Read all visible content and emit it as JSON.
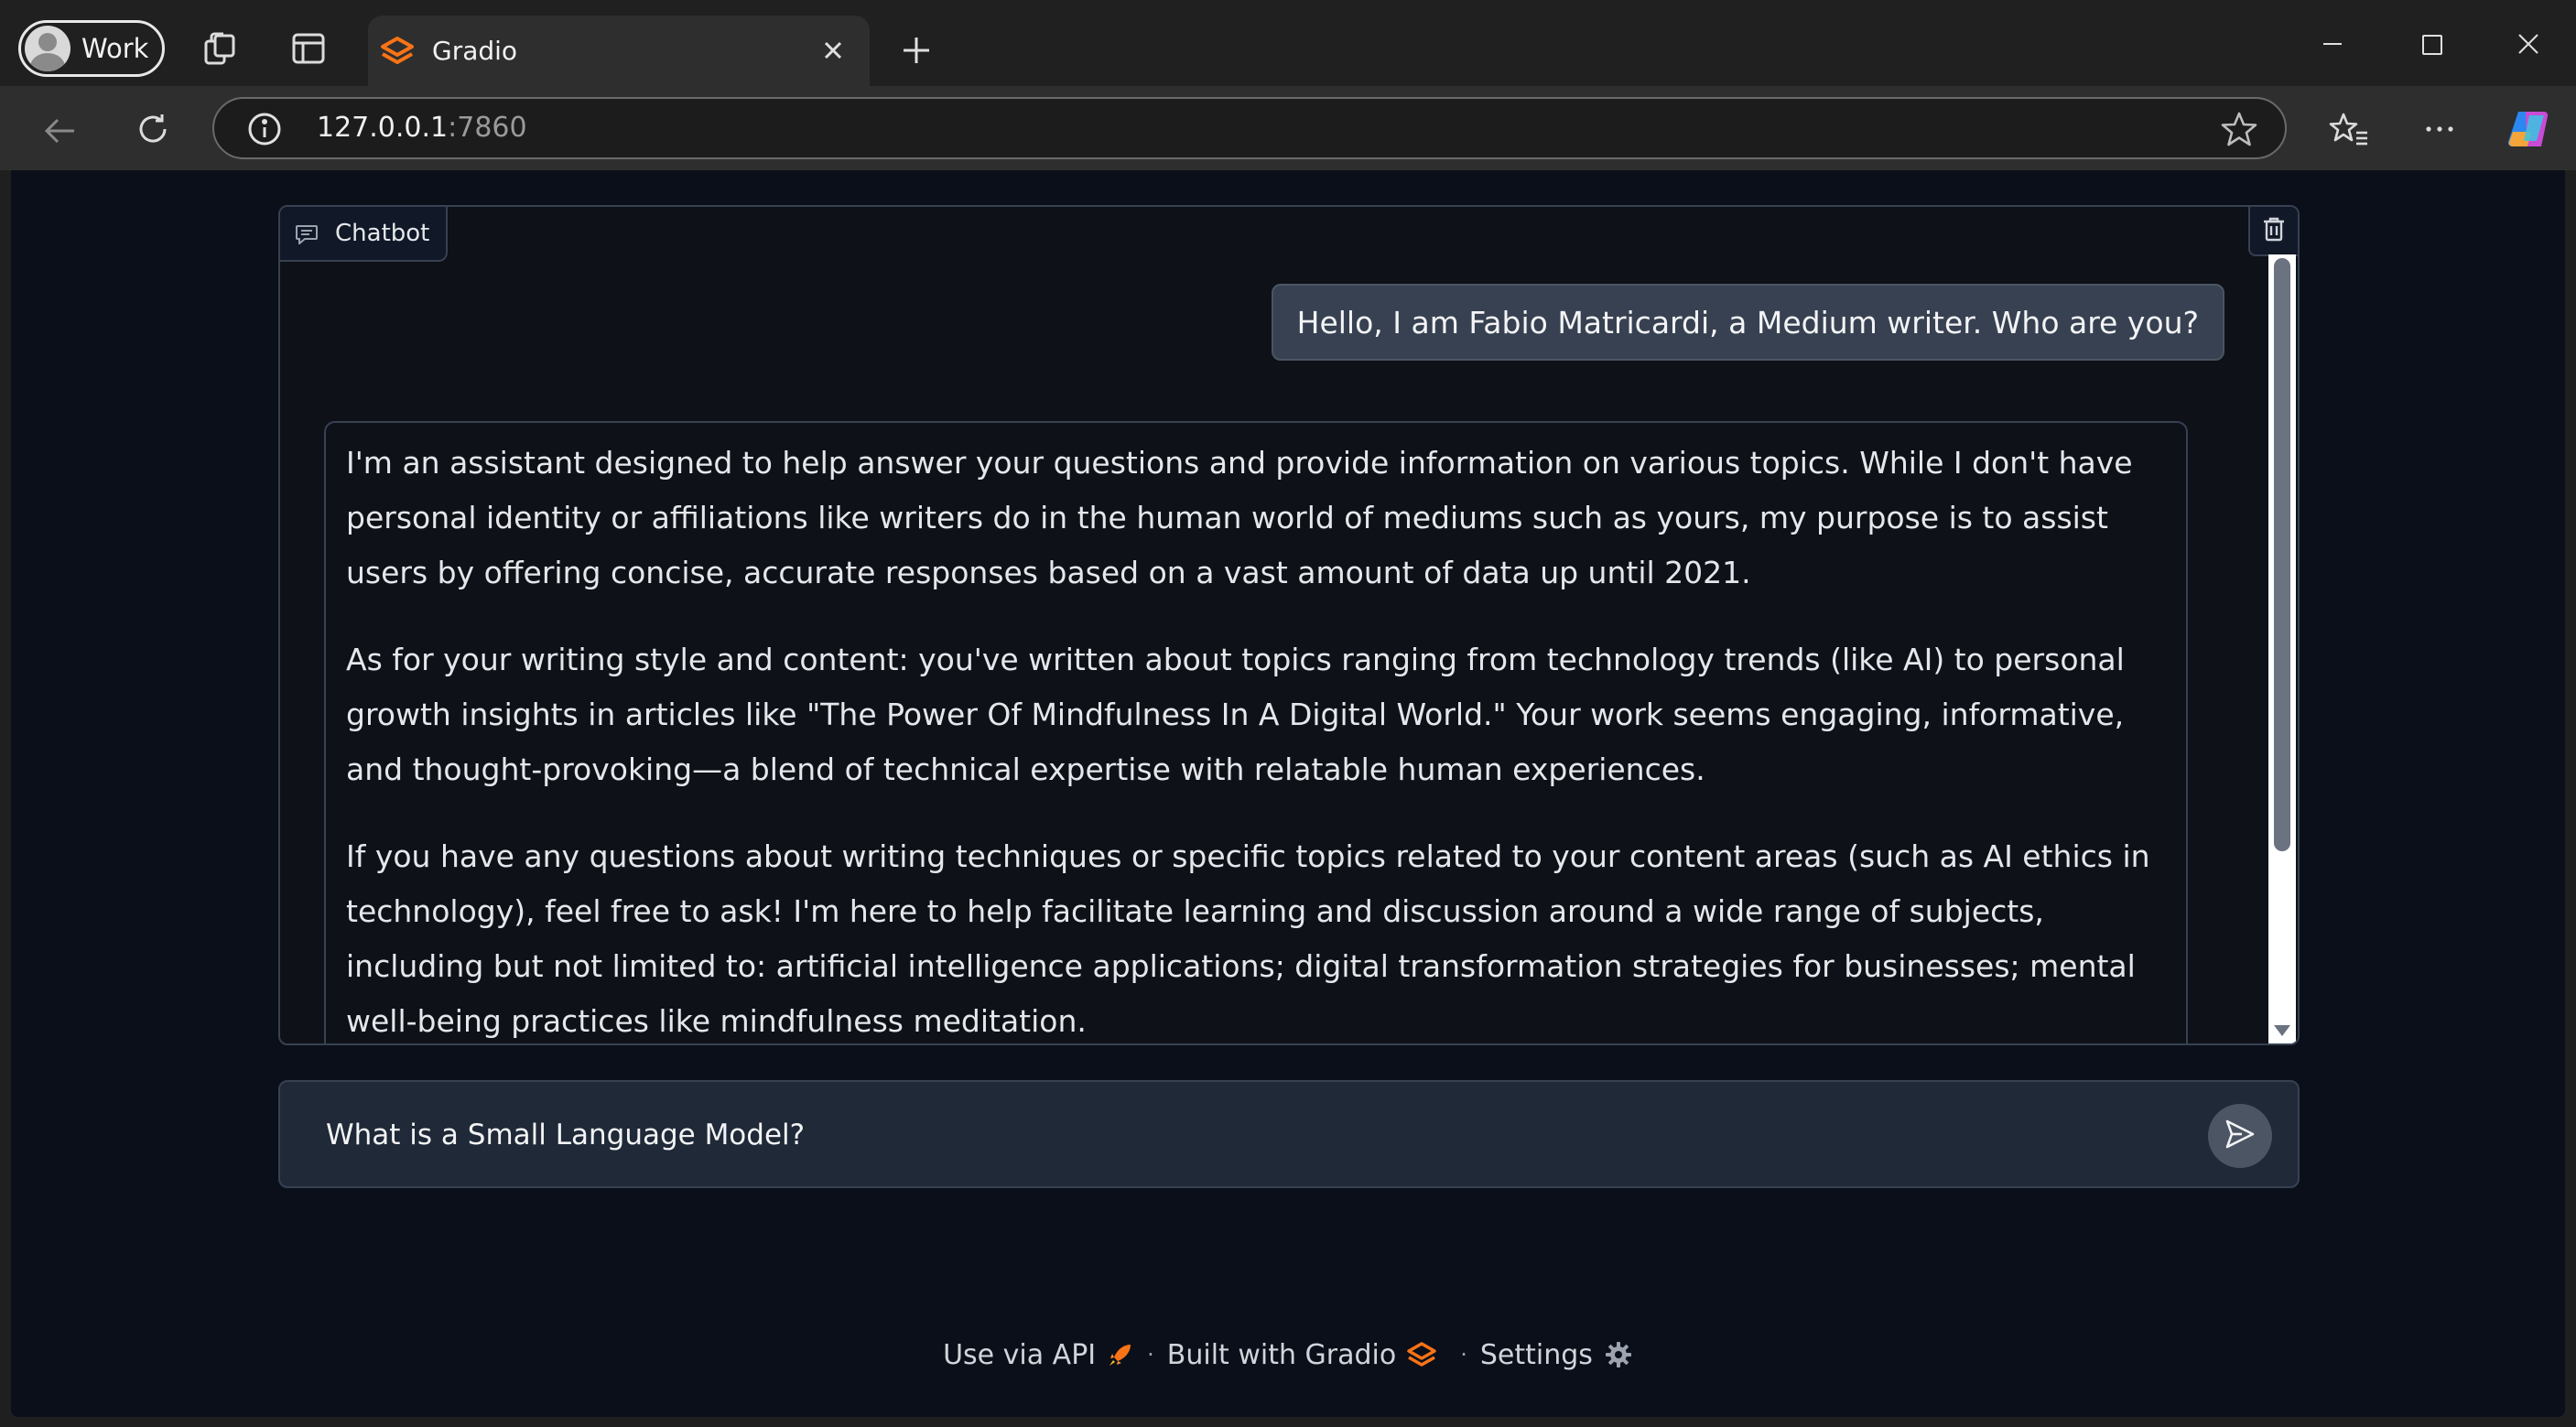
{
  "browser": {
    "profile_label": "Work",
    "tab_title": "Gradio",
    "url_host": "127.0.0.1",
    "url_port": ":7860"
  },
  "chatbot": {
    "label": "Chatbot",
    "messages": [
      {
        "role": "user",
        "text": "Hello, I am Fabio Matricardi, a Medium writer. Who are you?"
      },
      {
        "role": "assistant",
        "paragraphs": [
          "I'm an assistant designed to help answer your questions and provide information on various topics. While I don't have personal identity or affiliations like writers do in the human world of mediums such as yours, my purpose is to assist users by offering concise, accurate responses based on a vast amount of data up until 2021.",
          "As for your writing style and content: you've written about topics ranging from technology trends (like AI) to personal growth insights in articles like \"The Power Of Mindfulness In A Digital World.\" Your work seems engaging, informative, and thought-provoking—a blend of technical expertise with relatable human experiences.",
          "If you have any questions about writing techniques or specific topics related to your content areas (such as AI ethics in technology), feel free to ask! I'm here to help facilitate learning and discussion around a wide range of subjects, including but not limited to: artificial intelligence applications; digital transformation strategies for businesses; mental well-being practices like mindfulness meditation."
        ]
      }
    ]
  },
  "input": {
    "value": "What is a Small Language Model?"
  },
  "footer": {
    "api_label": "Use via API",
    "built_label": "Built with Gradio",
    "settings_label": "Settings",
    "separator": "·"
  },
  "colors": {
    "page_bg": "#0b0f19",
    "panel_border": "#374151",
    "gradio_orange": "#f97316"
  }
}
